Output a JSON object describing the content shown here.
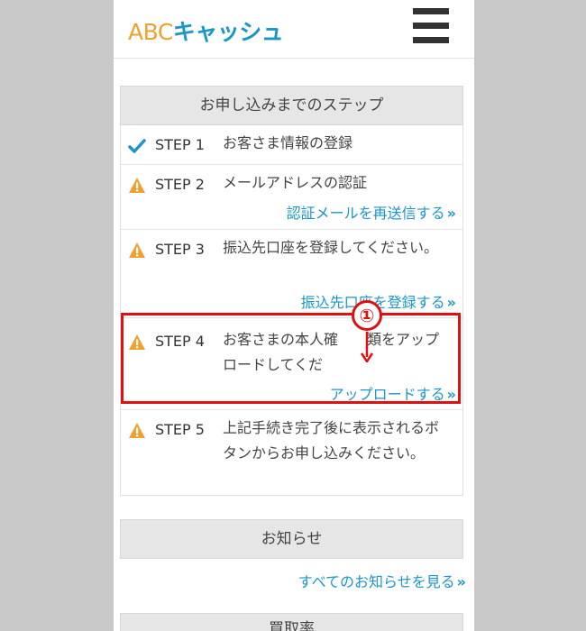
{
  "header": {
    "logo_abc": "ABC",
    "logo_rest": "キャッシュ",
    "menu_icon": "hamburger-icon"
  },
  "steps_section": {
    "title": "お申し込みまでのステップ",
    "steps": [
      {
        "number": "STEP 1",
        "text": "お客さま情報の登録",
        "status": "check-icon",
        "link": ""
      },
      {
        "number": "STEP 2",
        "text": "メールアドレスの認証",
        "status": "warning-icon",
        "link": "認証メールを再送信する"
      },
      {
        "number": "STEP 3",
        "text": "振込先口座を登録してください。",
        "status": "warning-icon",
        "link": "振込先口座を登録する"
      },
      {
        "number": "STEP 4",
        "text": "お客さまの本人確　　類をアップロードしてくだ",
        "status": "warning-icon",
        "link": "アップロードする"
      },
      {
        "number": "STEP 5",
        "text": "上記手続き完了後に表示されるボタンからお申し込みください。",
        "status": "warning-icon",
        "link": ""
      }
    ]
  },
  "annotation": {
    "label": "①",
    "color": "#e01010"
  },
  "news_section": {
    "title": "お知らせ",
    "link": "すべてのお知らせを見る"
  },
  "rate_section": {
    "title": "買取率"
  },
  "colors": {
    "accent": "#1a97c7",
    "warning": "#f0a030",
    "check": "#1a97c7",
    "highlight": "#e01010"
  }
}
